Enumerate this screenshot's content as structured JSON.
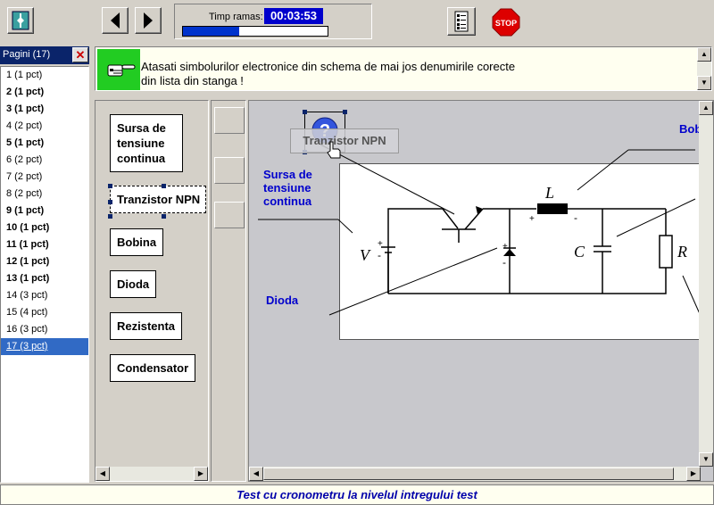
{
  "toolbar": {
    "home_icon": "split-pane-icon",
    "prev_label": "◀",
    "next_label": "▶",
    "timer_label": "Timp ramas:",
    "timer_value": "00:03:53",
    "timer_progress": 0.39,
    "list_icon": "list-icon",
    "stop_label": "STOP"
  },
  "pages": {
    "title": "Pagini (17)",
    "close_label": "✕",
    "items": [
      {
        "label": "1 (1 pct)",
        "bold": false
      },
      {
        "label": "2 (1 pct)",
        "bold": true
      },
      {
        "label": "3 (1 pct)",
        "bold": true
      },
      {
        "label": "4 (2 pct)",
        "bold": false
      },
      {
        "label": "5 (1 pct)",
        "bold": true
      },
      {
        "label": "6 (2 pct)",
        "bold": false
      },
      {
        "label": "7 (2 pct)",
        "bold": false
      },
      {
        "label": "8 (2 pct)",
        "bold": false
      },
      {
        "label": "9 (1 pct)",
        "bold": true
      },
      {
        "label": "10 (1 pct)",
        "bold": true
      },
      {
        "label": "11 (1 pct)",
        "bold": true
      },
      {
        "label": "12 (1 pct)",
        "bold": true
      },
      {
        "label": "13 (1 pct)",
        "bold": true
      },
      {
        "label": "14 (3 pct)",
        "bold": false
      },
      {
        "label": "15 (4 pct)",
        "bold": false
      },
      {
        "label": "16 (3 pct)",
        "bold": false
      },
      {
        "label": "17 (3 pct)",
        "bold": false,
        "selected": true
      }
    ]
  },
  "instruction": {
    "icon": "pointing-hand-icon",
    "line1": "Atasati simbolurilor electronice din schema de mai jos denumirile corecte",
    "line2": "din lista din stanga !"
  },
  "labels": [
    "Sursa de tensiune continua",
    "Tranzistor NPN",
    "Bobina",
    "Dioda",
    "Rezistenta",
    "Condensator"
  ],
  "canvas": {
    "placed_sursa": "Sursa de tensiune continua",
    "placed_dioda": "Dioda",
    "placed_bobina_partial": "Bob",
    "drag_text": "Tranzistor NPN",
    "drag_icon": "question-mark-icon",
    "cursor_icon": "hand-cursor-icon",
    "symbol_V": "V",
    "symbol_L": "L",
    "symbol_C": "C",
    "symbol_R": "R"
  },
  "status": "Test cu cronometru la nivelul intregului test"
}
